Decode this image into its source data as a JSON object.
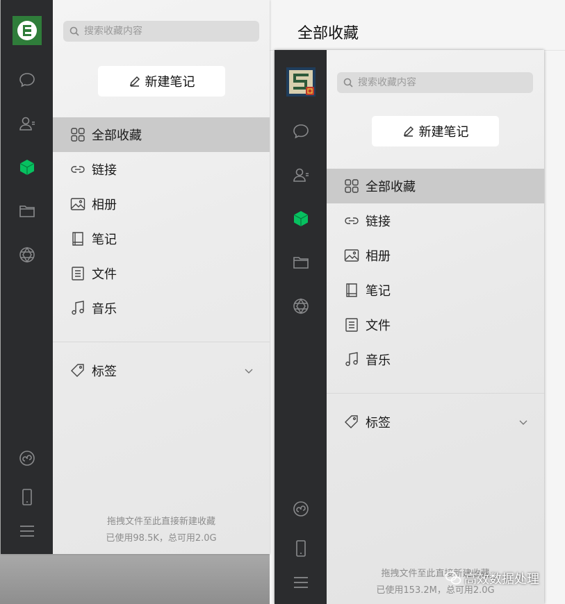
{
  "background_page": {
    "title": "全部收藏"
  },
  "windows": [
    {
      "search_placeholder": "搜索收藏内容",
      "new_note_label": "新建笔记",
      "nav_items": [
        {
          "label": "全部收藏",
          "icon": "grid-icon",
          "active": true
        },
        {
          "label": "链接",
          "icon": "link-icon"
        },
        {
          "label": "相册",
          "icon": "image-icon"
        },
        {
          "label": "笔记",
          "icon": "notebook-icon"
        },
        {
          "label": "文件",
          "icon": "document-icon"
        },
        {
          "label": "音乐",
          "icon": "music-note-icon"
        }
      ],
      "tags_label": "标签",
      "footer": {
        "hint": "拖拽文件至此直接新建收藏",
        "storage": "已使用98.5K，总可用2.0G"
      }
    },
    {
      "search_placeholder": "搜索收藏内容",
      "new_note_label": "新建笔记",
      "nav_items": [
        {
          "label": "全部收藏",
          "icon": "grid-icon",
          "active": true
        },
        {
          "label": "链接",
          "icon": "link-icon"
        },
        {
          "label": "相册",
          "icon": "image-icon"
        },
        {
          "label": "笔记",
          "icon": "notebook-icon"
        },
        {
          "label": "文件",
          "icon": "document-icon"
        },
        {
          "label": "音乐",
          "icon": "music-note-icon"
        }
      ],
      "tags_label": "标签",
      "footer": {
        "hint": "拖拽文件至此直接新建收藏",
        "storage": "已使用153.2M，总可用2.0G"
      }
    }
  ],
  "watermark": {
    "text": "高效数据处理"
  },
  "colors": {
    "rail": "#2b2c2e",
    "accent_green": "#07c160",
    "active_item": "#cacaca"
  }
}
